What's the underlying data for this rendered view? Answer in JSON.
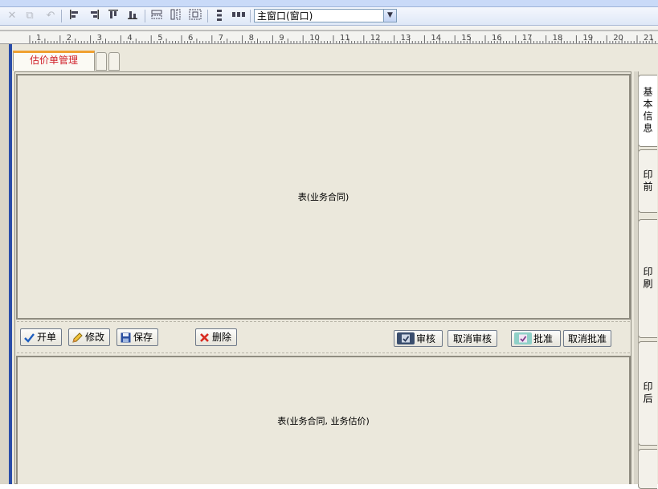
{
  "toolbar": {
    "window_select": {
      "value": "主窗口(窗口)"
    },
    "icons": [
      "cut-icon",
      "copy-icon",
      "undo-icon",
      "align-left-icon",
      "align-right-icon",
      "align-top-icon",
      "align-bottom-icon",
      "same-width-icon",
      "same-height-icon",
      "same-size-icon",
      "vertical-spacing-icon",
      "horizontal-spacing-icon"
    ]
  },
  "ruler": {
    "labels": [
      "1",
      "2",
      "3",
      "4",
      "5",
      "6",
      "7",
      "8",
      "9",
      "10",
      "11",
      "12",
      "13",
      "14",
      "15",
      "16",
      "17",
      "18",
      "19",
      "20",
      "21"
    ]
  },
  "tabs": {
    "active_label": "估价单管理"
  },
  "panels": {
    "top_label": "表(业务合同)",
    "bottom_label": "表(业务合同, 业务估价)"
  },
  "buttons": {
    "new_label": "开单",
    "edit_label": "修改",
    "save_label": "保存",
    "delete_label": "删除",
    "review_label": "审核",
    "cancel_review_label": "取消审核",
    "approve_label": "批准",
    "cancel_approve_label": "取消批准"
  },
  "side_tabs": {
    "basic_info": "基本信息",
    "prepress": "印前",
    "printing": "印刷",
    "postpress": "印后"
  }
}
